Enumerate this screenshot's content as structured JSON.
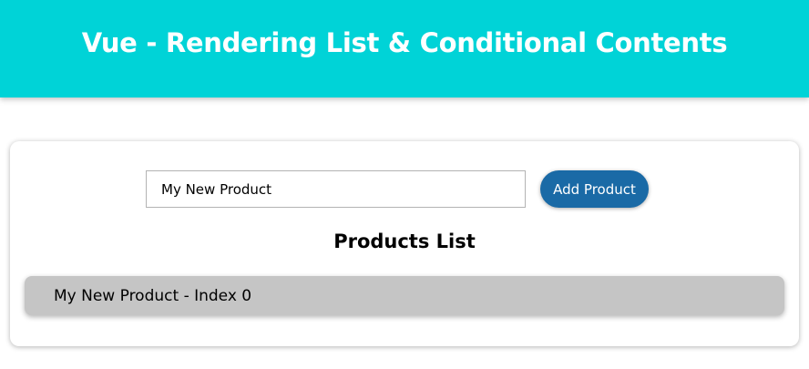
{
  "header": {
    "title": "Vue - Rendering List & Conditional Contents"
  },
  "form": {
    "input_value": "My New Product",
    "add_button_label": "Add Product"
  },
  "list": {
    "title": "Products List",
    "items": [
      {
        "label": "My New Product - Index 0"
      }
    ]
  },
  "colors": {
    "header_bg": "#00d3d7",
    "button_bg": "#1a6aa6",
    "item_bg": "#c5c5c5"
  }
}
